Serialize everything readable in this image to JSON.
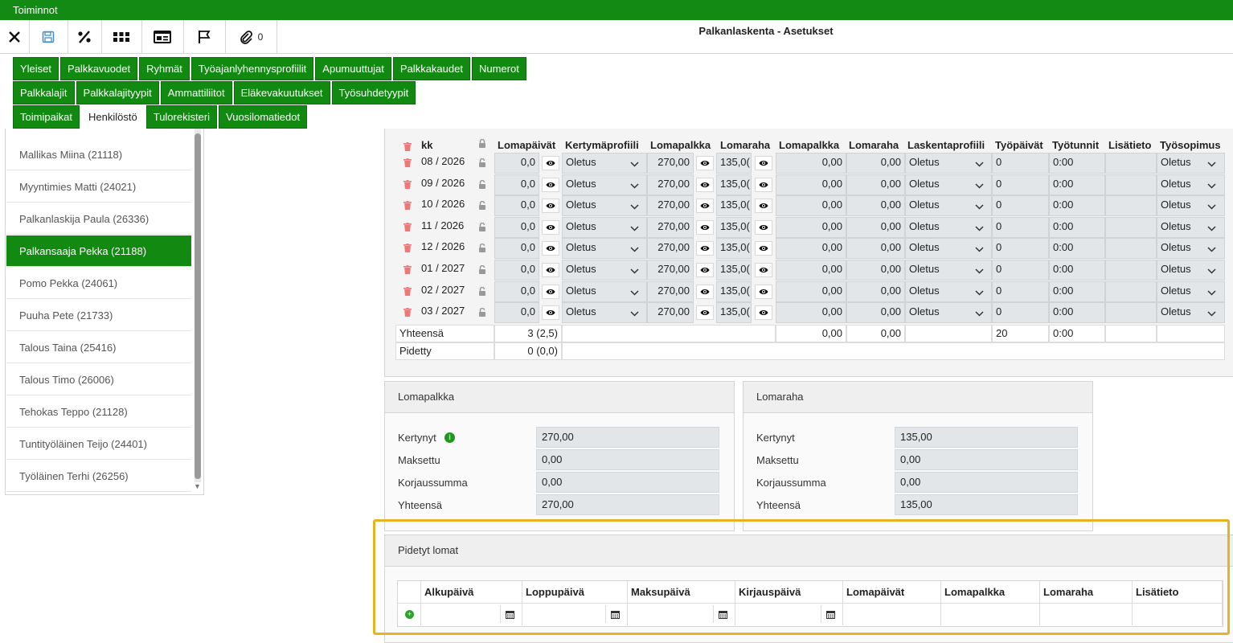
{
  "topbar": {
    "title": "Toiminnot"
  },
  "toolbar": {
    "page_title": "Palkanlaskenta - Asetukset",
    "attachment_count": "0"
  },
  "tabs": {
    "row1": [
      "Yleiset",
      "Palkkavuodet",
      "Ryhmät",
      "Työajanlyhennysprofiilit",
      "Apumuuttujat",
      "Palkkakaudet",
      "Numerot"
    ],
    "row2": [
      "Palkkalajit",
      "Palkkalajityypit",
      "Ammattiliitot",
      "Eläkevakuutukset",
      "Työsuhdetyypit"
    ],
    "row3": [
      "Toimipaikat",
      "Henkilöstö",
      "Tulorekisteri",
      "Vuosilomatiedot"
    ],
    "active": "Henkilöstö"
  },
  "persons": [
    "Mallikas Miina (21118)",
    "Myyntimies Matti (24021)",
    "Palkanlaskija Paula (26336)",
    "Palkansaaja Pekka (21188)",
    "Pomo Pekka (24061)",
    "Puuha Pete (21733)",
    "Talous Taina (25416)",
    "Talous Timo (26006)",
    "Tehokas Teppo (21128)",
    "Tuntityöläinen Teijo (24401)",
    "Työläinen Terhi (26256)"
  ],
  "selected_person": "Palkansaaja Pekka (21188)",
  "grid": {
    "headers": [
      "kk",
      "Lomapäivät",
      "Kertymäprofiili",
      "Lomapalkka",
      "Lomaraha",
      "Lomapalkka",
      "Lomaraha",
      "Laskentaprofiili",
      "Työpäivät",
      "Työtunnit",
      "Lisätieto",
      "Työsopimus"
    ],
    "rows": [
      {
        "kk": "08 / 2026",
        "lomapaivat": "0,0",
        "kertyma": "Oletus",
        "lomapalkka": "270,00",
        "lomaraha": "135,0(",
        "lp2": "0,00",
        "lr2": "0,00",
        "laskenta": "Oletus",
        "tp": "0",
        "tt": "0:00",
        "sopimus": "Oletus"
      },
      {
        "kk": "09 / 2026",
        "lomapaivat": "0,0",
        "kertyma": "Oletus",
        "lomapalkka": "270,00",
        "lomaraha": "135,0(",
        "lp2": "0,00",
        "lr2": "0,00",
        "laskenta": "Oletus",
        "tp": "0",
        "tt": "0:00",
        "sopimus": "Oletus"
      },
      {
        "kk": "10 / 2026",
        "lomapaivat": "0,0",
        "kertyma": "Oletus",
        "lomapalkka": "270,00",
        "lomaraha": "135,0(",
        "lp2": "0,00",
        "lr2": "0,00",
        "laskenta": "Oletus",
        "tp": "0",
        "tt": "0:00",
        "sopimus": "Oletus"
      },
      {
        "kk": "11 / 2026",
        "lomapaivat": "0,0",
        "kertyma": "Oletus",
        "lomapalkka": "270,00",
        "lomaraha": "135,0(",
        "lp2": "0,00",
        "lr2": "0,00",
        "laskenta": "Oletus",
        "tp": "0",
        "tt": "0:00",
        "sopimus": "Oletus"
      },
      {
        "kk": "12 / 2026",
        "lomapaivat": "0,0",
        "kertyma": "Oletus",
        "lomapalkka": "270,00",
        "lomaraha": "135,0(",
        "lp2": "0,00",
        "lr2": "0,00",
        "laskenta": "Oletus",
        "tp": "0",
        "tt": "0:00",
        "sopimus": "Oletus"
      },
      {
        "kk": "01 / 2027",
        "lomapaivat": "0,0",
        "kertyma": "Oletus",
        "lomapalkka": "270,00",
        "lomaraha": "135,0(",
        "lp2": "0,00",
        "lr2": "0,00",
        "laskenta": "Oletus",
        "tp": "0",
        "tt": "0:00",
        "sopimus": "Oletus"
      },
      {
        "kk": "02 / 2027",
        "lomapaivat": "0,0",
        "kertyma": "Oletus",
        "lomapalkka": "270,00",
        "lomaraha": "135,0(",
        "lp2": "0,00",
        "lr2": "0,00",
        "laskenta": "Oletus",
        "tp": "0",
        "tt": "0:00",
        "sopimus": "Oletus"
      },
      {
        "kk": "03 / 2027",
        "lomapaivat": "0,0",
        "kertyma": "Oletus",
        "lomapalkka": "270,00",
        "lomaraha": "135,0(",
        "lp2": "0,00",
        "lr2": "0,00",
        "laskenta": "Oletus",
        "tp": "0",
        "tt": "0:00",
        "sopimus": "Oletus"
      }
    ],
    "totals": {
      "label": "Yhteensä",
      "lomapaivat": "3 (2,5)",
      "lp2": "0,00",
      "lr2": "0,00",
      "tp": "20",
      "tt": "0:00"
    },
    "taken": {
      "label": "Pidetty",
      "lomapaivat": "0 (0,0)"
    }
  },
  "lomapalkka": {
    "title": "Lomapalkka",
    "rows": [
      {
        "label": "Kertynyt",
        "value": "270,00"
      },
      {
        "label": "Maksettu",
        "value": "0,00"
      },
      {
        "label": "Korjaussumma",
        "value": "0,00"
      },
      {
        "label": "Yhteensä",
        "value": "270,00"
      }
    ]
  },
  "lomaraha": {
    "title": "Lomaraha",
    "rows": [
      {
        "label": "Kertynyt",
        "value": "135,00"
      },
      {
        "label": "Maksettu",
        "value": "0,00"
      },
      {
        "label": "Korjaussumma",
        "value": "0,00"
      },
      {
        "label": "Yhteensä",
        "value": "135,00"
      }
    ]
  },
  "pidetyt": {
    "title": "Pidetyt lomat",
    "headers": [
      "Alkupäivä",
      "Loppupäivä",
      "Maksupäivä",
      "Kirjauspäivä",
      "Lomapäivät",
      "Lomapalkka",
      "Lomaraha",
      "Lisätieto"
    ]
  },
  "colors": {
    "green": "#128a12",
    "highlight": "#e6b322"
  },
  "icons": [
    "close-icon",
    "save-icon",
    "percent-icon",
    "grid-icon",
    "id-card-icon",
    "flag-icon",
    "paperclip-icon",
    "eye-icon",
    "trash-icon",
    "lock-icon",
    "chevron-down-icon",
    "calendar-icon",
    "info-icon",
    "add-icon"
  ]
}
